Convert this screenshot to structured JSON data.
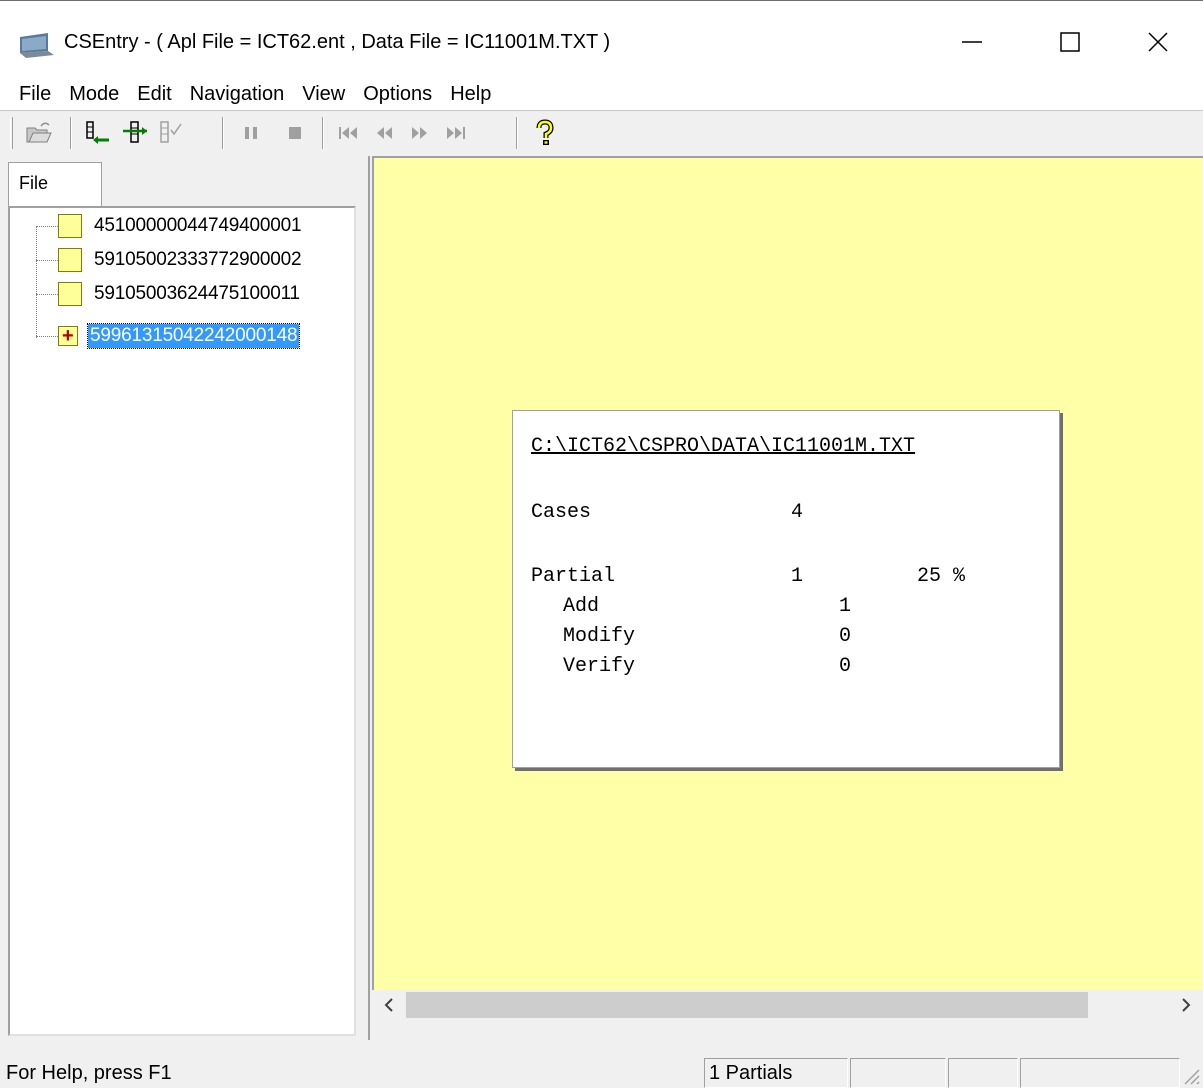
{
  "window": {
    "title": "CSEntry - ( Apl File = ICT62.ent , Data File = IC11001M.TXT )",
    "min_icon": "minimize-icon",
    "max_icon": "maximize-icon",
    "close_icon": "close-icon"
  },
  "menu": [
    "File",
    "Mode",
    "Edit",
    "Navigation",
    "View",
    "Options",
    "Help"
  ],
  "toolbar": {
    "icons": [
      "open-icon",
      "add-case-icon",
      "modify-case-icon",
      "verify-case-icon",
      "pause-icon",
      "stop-icon",
      "first-icon",
      "previous-icon",
      "next-icon",
      "last-icon",
      "help-icon"
    ]
  },
  "left_panel": {
    "tab_label": "File",
    "cases": [
      {
        "id": "45100000044749400001",
        "partial": false
      },
      {
        "id": "59105002333772900002",
        "partial": false
      },
      {
        "id": "59105003624475100011",
        "partial": false
      },
      {
        "id": "59961315042242000148",
        "partial": true,
        "selected": true
      }
    ]
  },
  "stats": {
    "path": "C:\\ICT62\\CSPRO\\DATA\\IC11001M.TXT",
    "cases_label": "Cases",
    "cases_value": "4",
    "partial_label": "Partial",
    "partial_value": "1",
    "partial_percent": "25 %",
    "add_label": "Add",
    "add_value": "1",
    "modify_label": "Modify",
    "modify_value": "0",
    "verify_label": "Verify",
    "verify_value": "0"
  },
  "statusbar": {
    "help_text": "For Help, press F1",
    "partials": "1 Partials"
  },
  "colors": {
    "data_area_bg": "#ffffa8",
    "selection": "#3399ff",
    "case_icon": "#ffff99"
  }
}
